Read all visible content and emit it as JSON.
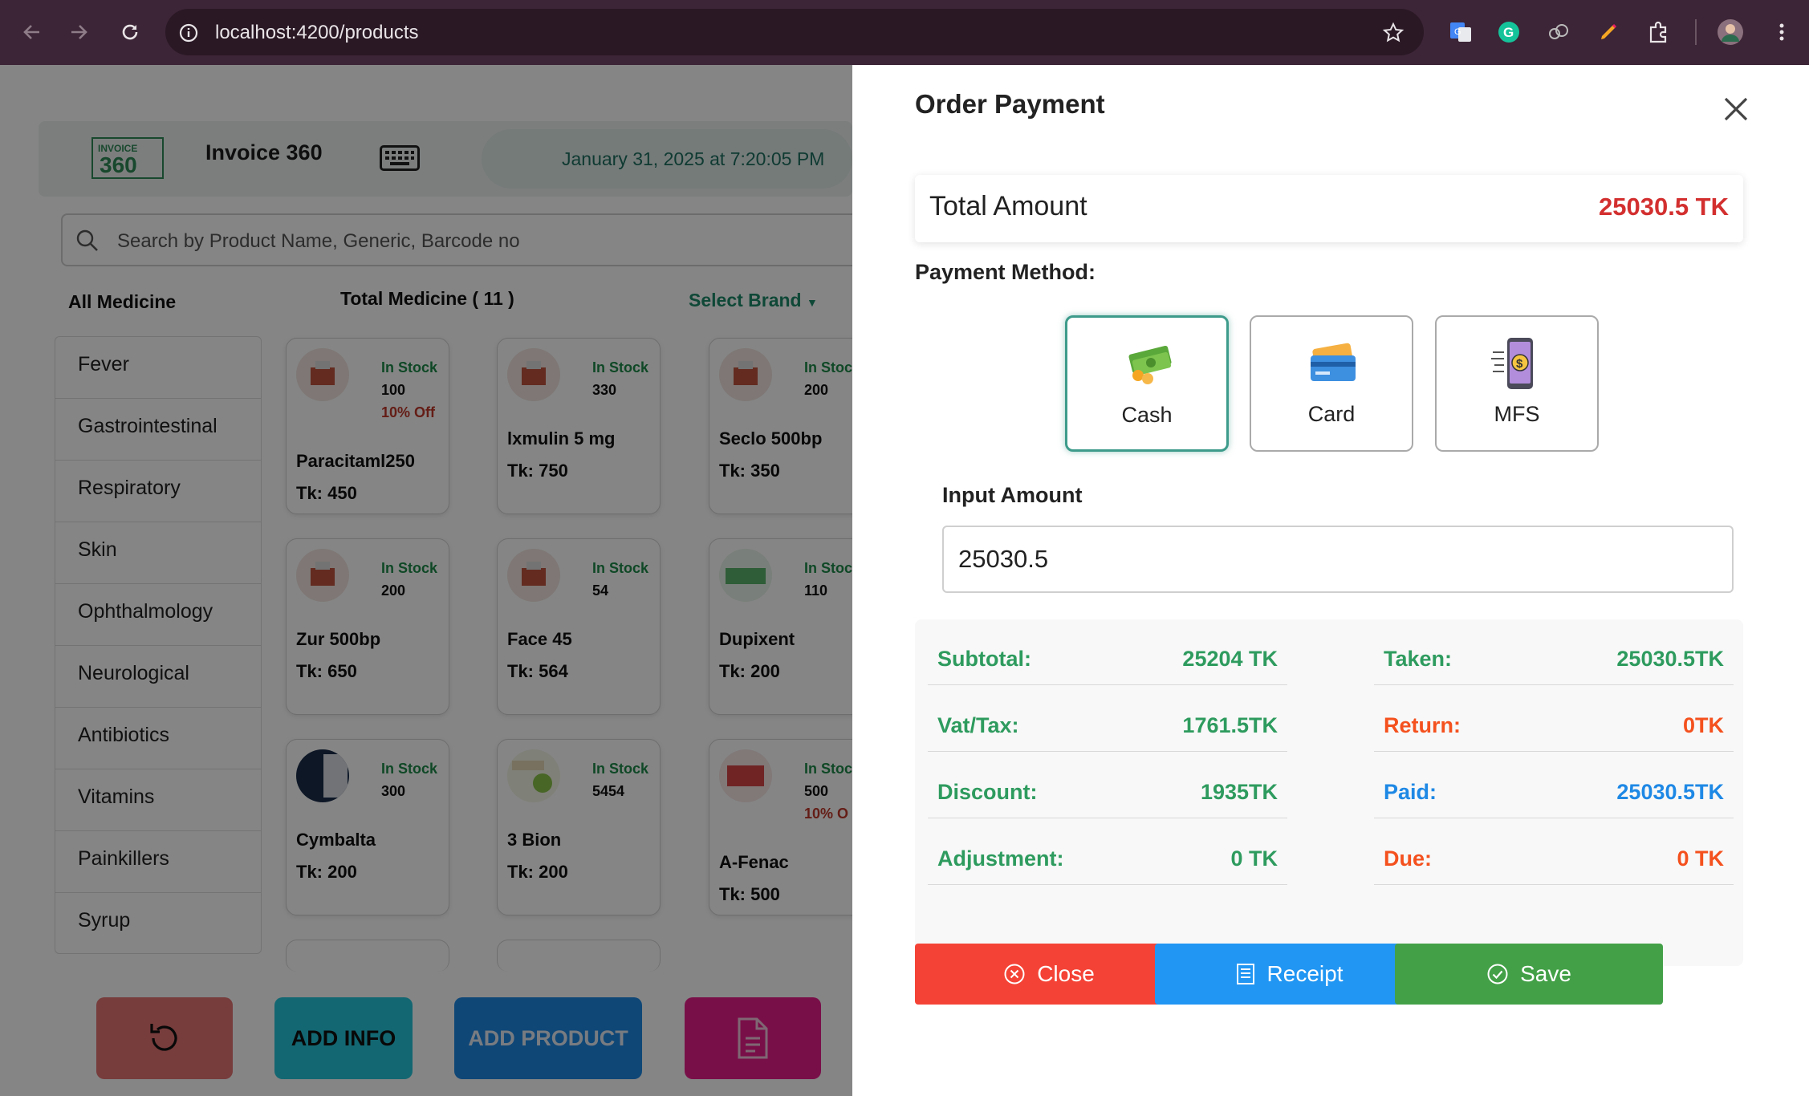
{
  "browser": {
    "url": "localhost:4200/products"
  },
  "app": {
    "title": "Invoice 360",
    "logo_text": "INVOICE 360",
    "datetime": "January 31, 2025 at 7:20:05 PM",
    "search_placeholder": "Search by Product Name, Generic, Barcode no",
    "all_medicine_label": "All Medicine",
    "total_medicine_label": "Total Medicine ( 11 )",
    "select_brand_label": "Select Brand",
    "categories": [
      "Fever",
      "Gastrointestinal",
      "Respiratory",
      "Skin",
      "Ophthalmology",
      "Neurological",
      "Antibiotics",
      "Vitamins",
      "Painkillers",
      "Syrup"
    ],
    "products": [
      {
        "name": "Paracitaml250",
        "stock_label": "In Stock",
        "qty": "100",
        "discount": "10% Off",
        "price": "Tk: 450"
      },
      {
        "name": "lxmulin 5 mg",
        "stock_label": "In Stock",
        "qty": "330",
        "discount": "",
        "price": "Tk: 750"
      },
      {
        "name": "Seclo 500bp",
        "stock_label": "In Stoc",
        "qty": "200",
        "discount": "",
        "price": "Tk: 350"
      },
      {
        "name": "Zur 500bp",
        "stock_label": "In Stock",
        "qty": "200",
        "discount": "",
        "price": "Tk: 650"
      },
      {
        "name": "Face 45",
        "stock_label": "In Stock",
        "qty": "54",
        "discount": "",
        "price": "Tk: 564"
      },
      {
        "name": "Dupixent",
        "stock_label": "In Stoc",
        "qty": "110",
        "discount": "",
        "price": "Tk: 200"
      },
      {
        "name": "Cymbalta",
        "stock_label": "In Stock",
        "qty": "300",
        "discount": "",
        "price": "Tk: 200"
      },
      {
        "name": "3 Bion",
        "stock_label": "In Stock",
        "qty": "5454",
        "discount": "",
        "price": "Tk: 200"
      },
      {
        "name": "A-Fenac",
        "stock_label": "In Stoc",
        "qty": "500",
        "discount": "10% O",
        "price": "Tk: 500"
      }
    ],
    "bottom_buttons": {
      "add_info": "ADD INFO",
      "add_product": "ADD PRODUCT"
    }
  },
  "modal": {
    "title": "Order Payment",
    "total_label": "Total Amount",
    "total_value": "25030.5 TK",
    "payment_method_label": "Payment Method:",
    "methods": [
      {
        "label": "Cash",
        "icon": "cash-icon",
        "selected": true
      },
      {
        "label": "Card",
        "icon": "credit-card-icon",
        "selected": false
      },
      {
        "label": "MFS",
        "icon": "mobile-payment-icon",
        "selected": false
      }
    ],
    "input_amount_label": "Input Amount",
    "input_amount_value": "25030.5",
    "summary_left": [
      {
        "label": "Subtotal:",
        "value": "25204 TK"
      },
      {
        "label": "Vat/Tax:",
        "value": "1761.5TK"
      },
      {
        "label": "Discount:",
        "value": "1935TK"
      },
      {
        "label": "Adjustment:",
        "value": "0 TK"
      }
    ],
    "summary_right": [
      {
        "label": "Taken:",
        "value": "25030.5TK"
      },
      {
        "label": "Return:",
        "value": "0TK"
      },
      {
        "label": "Paid:",
        "value": "25030.5TK"
      },
      {
        "label": "Due:",
        "value": "0 TK"
      }
    ],
    "actions": {
      "close": "Close",
      "receipt": "Receipt",
      "save": "Save"
    }
  },
  "colors": {
    "green": "#2e9b5e",
    "red": "#d32f2f",
    "orange_red": "#f4511e",
    "blue": "#1e88e5",
    "close_button": "#f44336",
    "receipt_button": "#2196f3",
    "save_button": "#43a047"
  }
}
